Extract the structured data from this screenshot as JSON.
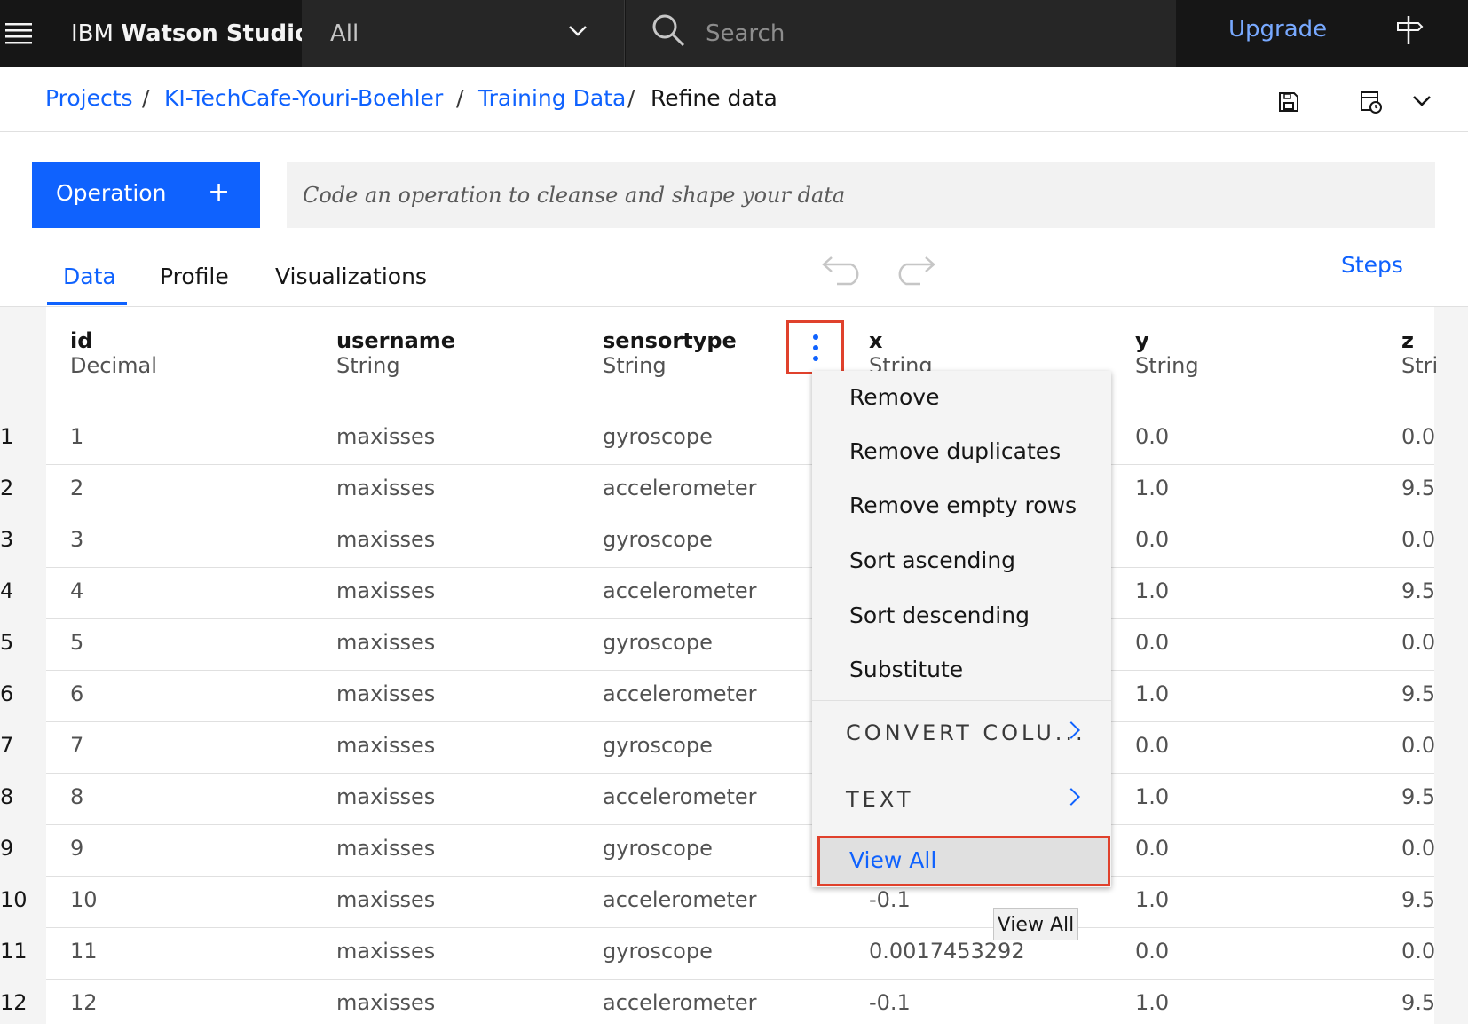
{
  "topbar": {
    "brand_prefix": "IBM",
    "brand_name": "Watson Studio",
    "scope": "All",
    "search_placeholder": "Search",
    "upgrade": "Upgrade"
  },
  "breadcrumb": {
    "items": [
      "Projects",
      "KI-TechCafe-Youri-Boehler",
      "Training Data"
    ],
    "current": "Refine data",
    "separator": "/"
  },
  "operation": {
    "button_label": "Operation",
    "button_icon": "+",
    "code_placeholder": "Code an operation to cleanse and shape your data"
  },
  "tabs": [
    "Data",
    "Profile",
    "Visualizations"
  ],
  "active_tab": "Data",
  "steps_label": "Steps",
  "columns": [
    {
      "name": "id",
      "type": "Decimal"
    },
    {
      "name": "username",
      "type": "String"
    },
    {
      "name": "sensortype",
      "type": "String"
    },
    {
      "name": "x",
      "type": "String"
    },
    {
      "name": "y",
      "type": "String"
    },
    {
      "name": "z",
      "type": "Stri"
    }
  ],
  "rows": [
    {
      "n": "1",
      "id": "1",
      "username": "maxisses",
      "sensortype": "gyroscope",
      "x": "",
      "y": "0.0",
      "z": "0.0"
    },
    {
      "n": "2",
      "id": "2",
      "username": "maxisses",
      "sensortype": "accelerometer",
      "x": "",
      "y": "1.0",
      "z": "9.5"
    },
    {
      "n": "3",
      "id": "3",
      "username": "maxisses",
      "sensortype": "gyroscope",
      "x": "",
      "y": "0.0",
      "z": "0.0"
    },
    {
      "n": "4",
      "id": "4",
      "username": "maxisses",
      "sensortype": "accelerometer",
      "x": "",
      "y": "1.0",
      "z": "9.5"
    },
    {
      "n": "5",
      "id": "5",
      "username": "maxisses",
      "sensortype": "gyroscope",
      "x": "",
      "y": "0.0",
      "z": "0.0"
    },
    {
      "n": "6",
      "id": "6",
      "username": "maxisses",
      "sensortype": "accelerometer",
      "x": "",
      "y": "1.0",
      "z": "9.5"
    },
    {
      "n": "7",
      "id": "7",
      "username": "maxisses",
      "sensortype": "gyroscope",
      "x": "",
      "y": "0.0",
      "z": "0.0"
    },
    {
      "n": "8",
      "id": "8",
      "username": "maxisses",
      "sensortype": "accelerometer",
      "x": "",
      "y": "1.0",
      "z": "9.5"
    },
    {
      "n": "9",
      "id": "9",
      "username": "maxisses",
      "sensortype": "gyroscope",
      "x": "",
      "y": "0.0",
      "z": "0.0"
    },
    {
      "n": "10",
      "id": "10",
      "username": "maxisses",
      "sensortype": "accelerometer",
      "x": "-0.1",
      "y": "1.0",
      "z": "9.5"
    },
    {
      "n": "11",
      "id": "11",
      "username": "maxisses",
      "sensortype": "gyroscope",
      "x": "0.0017453292",
      "y": "0.0",
      "z": "0.0"
    },
    {
      "n": "12",
      "id": "12",
      "username": "maxisses",
      "sensortype": "accelerometer",
      "x": "-0.1",
      "y": "1.0",
      "z": "9.5"
    }
  ],
  "menu": {
    "items": [
      "Remove",
      "Remove duplicates",
      "Remove empty rows",
      "Sort ascending",
      "Sort descending",
      "Substitute"
    ],
    "groups": [
      "CONVERT COLU...",
      "TEXT"
    ],
    "view_all": "View All"
  },
  "tooltip": "View All",
  "colors": {
    "accent": "#0f62fe",
    "highlight": "#e0412c",
    "topbar": "#161616"
  }
}
